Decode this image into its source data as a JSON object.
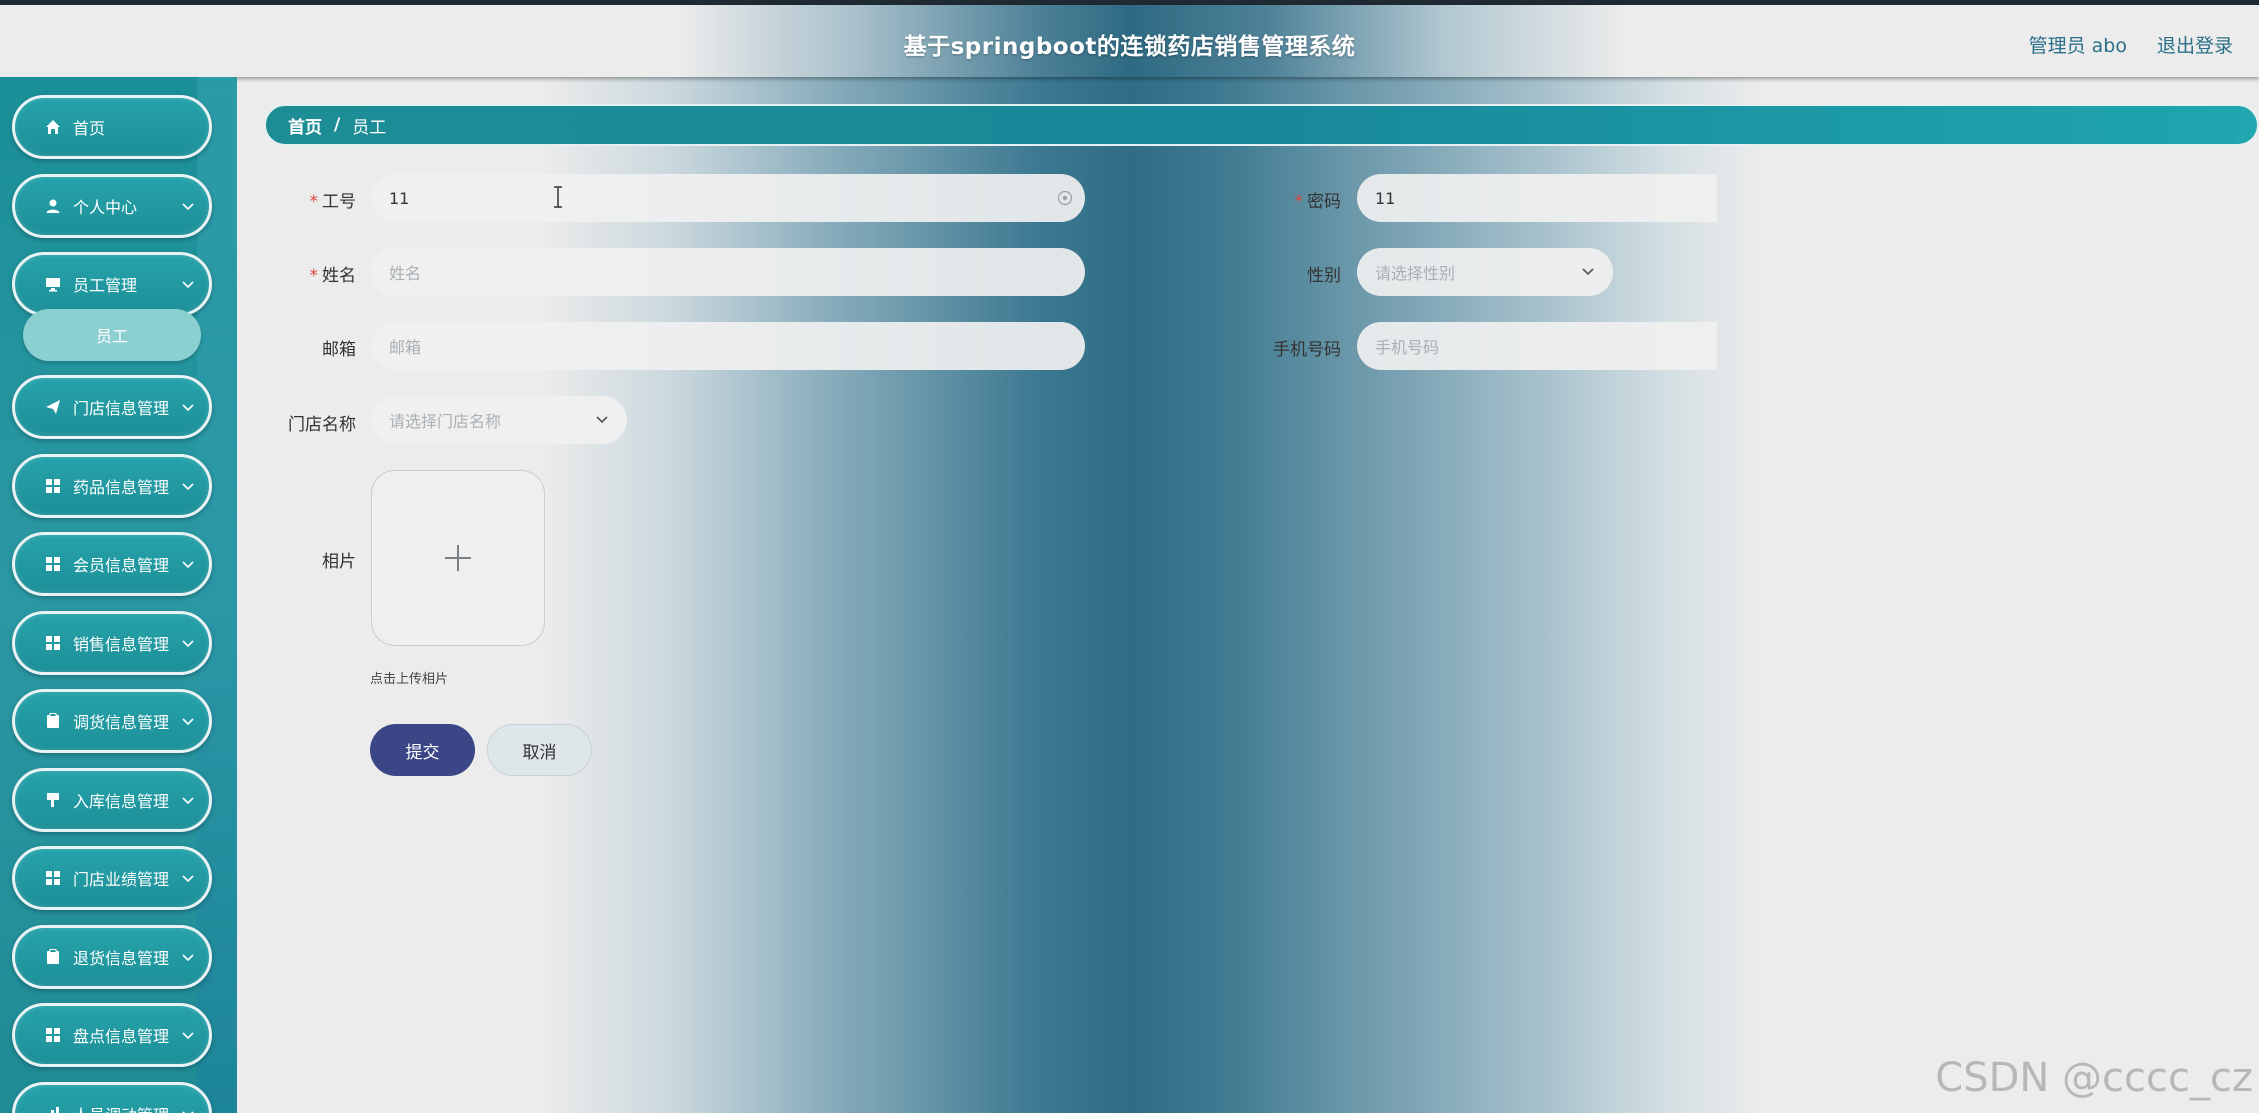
{
  "header": {
    "title": "基于springboot的连锁药店销售管理系统",
    "user": "管理员 abo",
    "logout": "退出登录"
  },
  "sidebar": {
    "items": [
      {
        "label": "首页",
        "icon": "home-icon"
      },
      {
        "label": "个人中心",
        "icon": "user-icon"
      },
      {
        "label": "员工管理",
        "icon": "monitor-icon"
      },
      {
        "label": "门店信息管理",
        "icon": "send-icon"
      },
      {
        "label": "药品信息管理",
        "icon": "grid-icon"
      },
      {
        "label": "会员信息管理",
        "icon": "grid-icon"
      },
      {
        "label": "销售信息管理",
        "icon": "grid-icon"
      },
      {
        "label": "调货信息管理",
        "icon": "clipboard-icon"
      },
      {
        "label": "入库信息管理",
        "icon": "flag-icon"
      },
      {
        "label": "门店业绩管理",
        "icon": "grid-icon"
      },
      {
        "label": "退货信息管理",
        "icon": "clipboard-icon"
      },
      {
        "label": "盘点信息管理",
        "icon": "grid-icon"
      },
      {
        "label": "人员调动管理",
        "icon": "chart-icon"
      }
    ],
    "sub_item": "员工"
  },
  "breadcrumb": {
    "home": "首页",
    "separator": "/",
    "current": "员工"
  },
  "form": {
    "employee_no": {
      "label": "工号",
      "value": "11"
    },
    "password": {
      "label": "密码",
      "value": "11"
    },
    "name": {
      "label": "姓名",
      "placeholder": "姓名"
    },
    "gender": {
      "label": "性别",
      "placeholder": "请选择性别"
    },
    "email": {
      "label": "邮箱",
      "placeholder": "邮箱"
    },
    "phone": {
      "label": "手机号码",
      "placeholder": "手机号码"
    },
    "store": {
      "label": "门店名称",
      "placeholder": "请选择门店名称"
    },
    "photo": {
      "label": "相片",
      "tip": "点击上传相片"
    },
    "submit": "提交",
    "cancel": "取消"
  },
  "watermark": "CSDN @cccc_cz",
  "colors": {
    "sidebar": "#1d9099",
    "breadcrumb": "#18889a",
    "submit": "#3a4686",
    "required": "#e0463c"
  }
}
